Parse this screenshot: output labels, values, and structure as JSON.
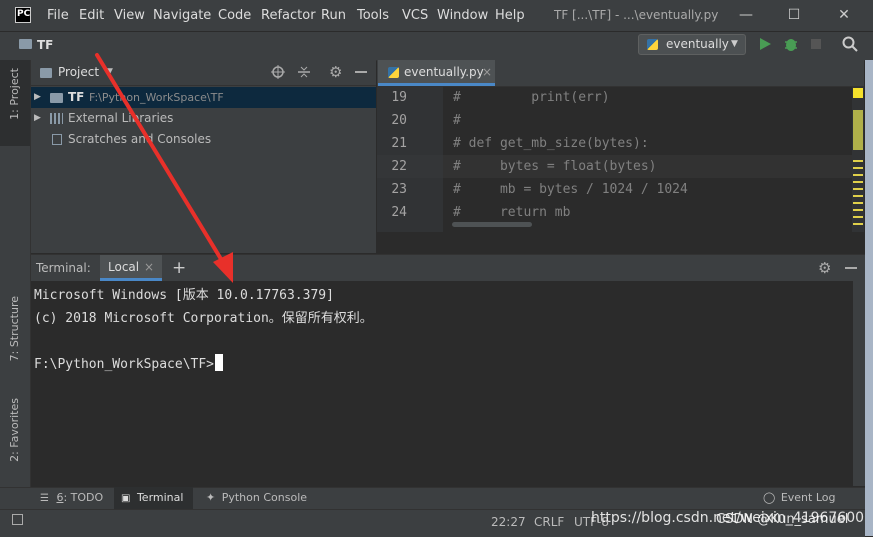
{
  "titlebar": {
    "logo": "PC",
    "menu": [
      "File",
      "Edit",
      "View",
      "Navigate",
      "Code",
      "Refactor",
      "Run",
      "Tools",
      "VCS",
      "Window",
      "Help"
    ],
    "window_title": "TF [...\\TF] - ...\\eventually.py",
    "controls": {
      "minimize": "—",
      "maximize": "☐",
      "close": "✕"
    }
  },
  "navbar": {
    "breadcrumb": "TF",
    "run_config": "eventually",
    "icons": [
      "run-icon",
      "debug-icon",
      "stop-icon",
      "search-icon"
    ]
  },
  "left_stripe": {
    "project_tab": "1: Project",
    "structure_tab": "7: Structure",
    "favorites_tab": "2: Favorites"
  },
  "project_panel": {
    "title": "Project",
    "tree": [
      {
        "name": "TF",
        "path": "F:\\Python_WorkSpace\\TF",
        "selected": true
      },
      {
        "name": "External Libraries",
        "path": "",
        "selected": false
      },
      {
        "name": "Scratches and Consoles",
        "path": "",
        "selected": false
      }
    ]
  },
  "editor": {
    "tab_label": "eventually.py",
    "lines": [
      {
        "no": "19",
        "text": "#         print(err)"
      },
      {
        "no": "20",
        "text": "#"
      },
      {
        "no": "21",
        "text": "# def get_mb_size(bytes):"
      },
      {
        "no": "22",
        "text": "#     bytes = float(bytes)"
      },
      {
        "no": "23",
        "text": "#     mb = bytes / 1024 / 1024"
      },
      {
        "no": "24",
        "text": "#     return mb"
      }
    ]
  },
  "terminal": {
    "label": "Terminal:",
    "tab": "Local",
    "close": "×",
    "add": "+",
    "lines": [
      "Microsoft Windows [版本 10.0.17763.379]",
      "(c) 2018 Microsoft Corporation。保留所有权利。",
      "",
      "F:\\Python_WorkSpace\\TF>"
    ]
  },
  "bottom_tabs": {
    "todo_no": "6",
    "todo": ": TODO",
    "terminal": "Terminal",
    "python_console": "Python Console",
    "event_log": "Event Log"
  },
  "statusbar": {
    "position": "22:27",
    "line_sep": "CRLF",
    "encoding": "UTF-8",
    "watermark": "https://blog.csdn.net/weixin_41967600",
    "watermark2": "CSDN @Kun_samuel"
  },
  "colors": {
    "accent": "#4a88c7",
    "arrow": "#e8302a",
    "bg": "#2b2b2b",
    "panel": "#3c3f41"
  }
}
